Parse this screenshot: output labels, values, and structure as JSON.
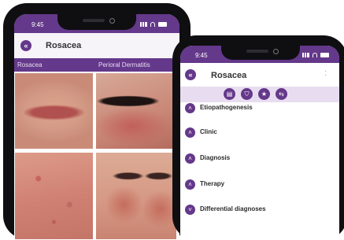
{
  "colors": {
    "brand": "#64388a",
    "brand_light": "#e8ddf0",
    "bezel": "#0f0f12"
  },
  "left_phone": {
    "status_time": "9:45",
    "title": "Rosacea",
    "categories": [
      "Rosacea",
      "Perioral Dermatitis"
    ]
  },
  "right_phone": {
    "status_time": "9:45",
    "title": "Rosacea",
    "action_icons": [
      "layers-icon",
      "bookmark-icon",
      "star-icon",
      "share-icon"
    ],
    "sections": [
      {
        "label": "Etiopathogenesis",
        "icon": "chevron-up-icon"
      },
      {
        "label": "Clinic",
        "icon": "chevron-up-icon"
      },
      {
        "label": "Diagnosis",
        "icon": "chevron-up-icon"
      },
      {
        "label": "Therapy",
        "icon": "chevron-up-icon"
      },
      {
        "label": "Differential diagnoses",
        "icon": "chevron-down-icon"
      }
    ]
  }
}
